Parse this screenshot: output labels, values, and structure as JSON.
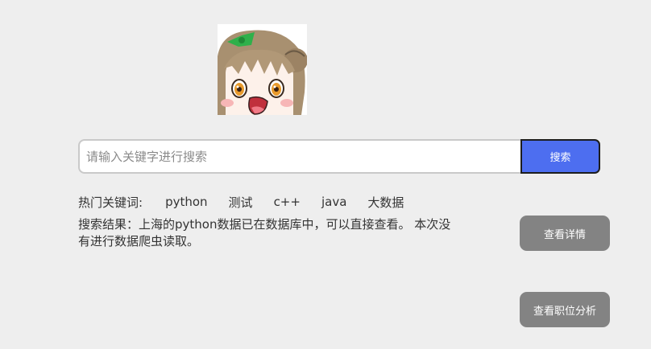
{
  "avatar": {
    "icon": "anime-girl-avatar-icon"
  },
  "search": {
    "placeholder": "请输入关键字进行搜索",
    "value": "",
    "button_label": "搜索",
    "button_color": "#4d6ef0"
  },
  "hot_keywords": {
    "label": "热门关键词:",
    "items": [
      "python",
      "测试",
      "c++",
      "java",
      "大数据"
    ]
  },
  "result": {
    "line1": "搜索结果：上海的python数据已在数据库中，可以直接查看。 本次没",
    "line2": "有进行数据爬虫读取。"
  },
  "buttons": {
    "detail_label": "查看详情",
    "analysis_label": "查看职位分析",
    "color": "#838383"
  }
}
